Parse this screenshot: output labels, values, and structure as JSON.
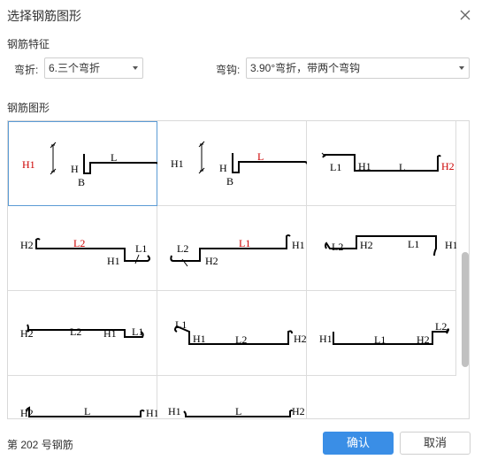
{
  "dialog": {
    "title": "选择钢筋图形",
    "close_icon": "close-icon"
  },
  "features": {
    "section_label": "钢筋特征",
    "bend_label": "弯折:",
    "bend_value": "6.三个弯折",
    "hook_label": "弯钩:",
    "hook_value": "3.90°弯折，带两个弯钩"
  },
  "shapes": {
    "section_label": "钢筋图形",
    "selected_index": 0,
    "cells": [
      {
        "labels": [
          {
            "t": "H1",
            "red": true
          },
          {
            "t": "H",
            "red": false
          },
          {
            "t": "B",
            "red": false
          },
          {
            "t": "L",
            "red": false
          }
        ]
      },
      {
        "labels": [
          {
            "t": "H1",
            "red": false
          },
          {
            "t": "H",
            "red": false
          },
          {
            "t": "B",
            "red": false
          },
          {
            "t": "L",
            "red": true
          }
        ]
      },
      {
        "labels": [
          {
            "t": "L1",
            "red": false
          },
          {
            "t": "H1",
            "red": false
          },
          {
            "t": "L",
            "red": false
          },
          {
            "t": "H2",
            "red": true
          }
        ]
      },
      {
        "labels": [
          {
            "t": "H2",
            "red": false
          },
          {
            "t": "L2",
            "red": true
          },
          {
            "t": "L1",
            "red": false
          },
          {
            "t": "H1",
            "red": false
          }
        ]
      },
      {
        "labels": [
          {
            "t": "L2",
            "red": false
          },
          {
            "t": "L1",
            "red": true
          },
          {
            "t": "H1",
            "red": false
          },
          {
            "t": "H2",
            "red": false
          }
        ]
      },
      {
        "labels": [
          {
            "t": "L2",
            "red": false
          },
          {
            "t": "H2",
            "red": false
          },
          {
            "t": "L1",
            "red": false
          },
          {
            "t": "H1",
            "red": false
          }
        ]
      },
      {
        "labels": [
          {
            "t": "H2",
            "red": false
          },
          {
            "t": "L2",
            "red": false
          },
          {
            "t": "H1",
            "red": false
          },
          {
            "t": "L1",
            "red": false
          }
        ]
      },
      {
        "labels": [
          {
            "t": "L1",
            "red": false
          },
          {
            "t": "H1",
            "red": false
          },
          {
            "t": "L2",
            "red": false
          },
          {
            "t": "H2",
            "red": false
          }
        ]
      },
      {
        "labels": [
          {
            "t": "H1",
            "red": false
          },
          {
            "t": "L1",
            "red": false
          },
          {
            "t": "H2",
            "red": false
          },
          {
            "t": "L2",
            "red": false
          }
        ]
      },
      {
        "labels": [
          {
            "t": "H2",
            "red": false
          },
          {
            "t": "L",
            "red": false
          },
          {
            "t": "H1",
            "red": false
          }
        ]
      },
      {
        "labels": [
          {
            "t": "H1",
            "red": false
          },
          {
            "t": "L",
            "red": false
          },
          {
            "t": "H2",
            "red": false
          }
        ]
      }
    ]
  },
  "footer": {
    "shape_number": "第 202 号钢筋",
    "confirm_label": "确认",
    "cancel_label": "取消"
  },
  "colors": {
    "primary": "#3a8ee6",
    "highlight_label": "#cc0000",
    "selected_border": "#5b9bd5"
  }
}
